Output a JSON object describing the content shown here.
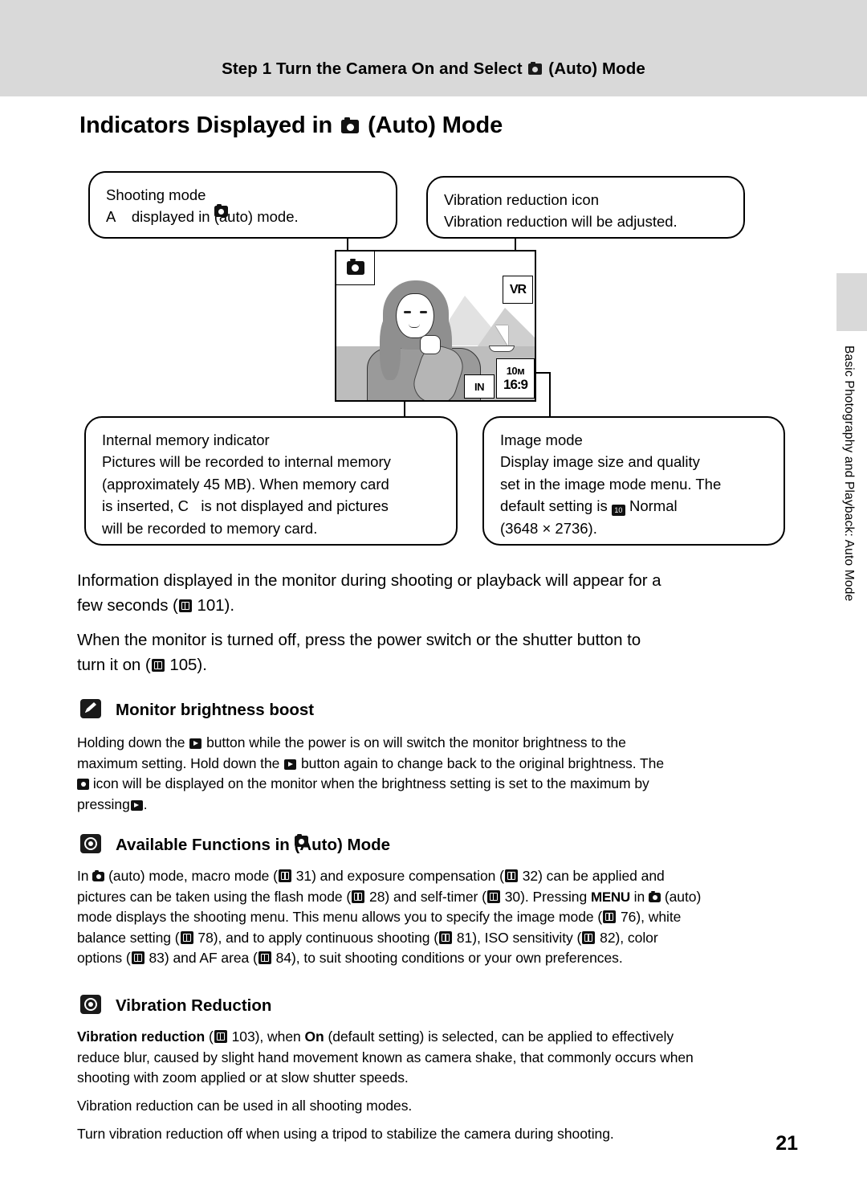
{
  "header": {
    "step_text_before": "Step 1 Turn the Camera On and Select",
    "step_text_after": "(Auto) Mode"
  },
  "title": {
    "before": "Indicators Displayed in",
    "after": "(Auto) Mode"
  },
  "side_tab_text": "Basic Photography and Playback: Auto Mode",
  "callouts": {
    "shooting_mode": {
      "line1": "Shooting mode",
      "line2_a": "A",
      "line2_b": "displayed in",
      "line2_c": "(auto) mode."
    },
    "vibration_reduction": {
      "line1": "Vibration reduction icon",
      "line2": "Vibration reduction will be adjusted."
    },
    "internal_memory": {
      "line1": "Internal memory indicator",
      "line2": "Pictures will be recorded to internal memory",
      "line3": "(approximately 45 MB). When memory card",
      "line4_a": "is inserted,",
      "line4_b": "C",
      "line4_c": "is not displayed and pictures",
      "line5": "will be recorded to memory card."
    },
    "image_mode": {
      "line1": "Image mode",
      "line2": "Display image size and quality",
      "line3": "set in the image mode menu. The",
      "line4_a": "default setting is",
      "line4_b": "Normal",
      "line5": "(3648 × 2736)."
    }
  },
  "monitor": {
    "mode_icon": "camera-auto-icon",
    "vr_icon_label": "VR",
    "internal_memory_label": "IN",
    "image_mode_top": "10м",
    "image_mode_bottom": "16:9"
  },
  "body": {
    "p1_a": "Information displayed in the monitor during shooting or playback will appear for a",
    "p1_b": "few seconds (",
    "p1_page": "101",
    "p1_c": ").",
    "p2_a": "When the monitor is turned off, press the power switch or the shutter button to",
    "p2_b": "turn it on (",
    "p2_page": "105",
    "p2_c": ")."
  },
  "sections": [
    {
      "icon": "pencil-icon",
      "heading": "Monitor brightness boost",
      "lines": [
        "Holding down the ▶ button while the power is on will switch the monitor brightness to the",
        "maximum setting. Hold down the ▶ button again to change back to the original brightness. The",
        "icon will be displayed on the monitor when the brightness setting is set to the maximum by",
        "pressing ▶."
      ]
    },
    {
      "icon": "note-icon",
      "heading_before": "Available Functions in",
      "heading_after": "(Auto) Mode",
      "lines": [
        "In  (auto) mode, macro mode ( 31) and exposure compensation ( 32) can be applied and",
        "pictures can be taken using the flash mode ( 28) and self-timer ( 30). Pressing MENU in  (auto)",
        "mode displays the shooting menu. This menu allows you to specify the image mode ( 76), white",
        "balance setting ( 78), and to apply continuous shooting ( 81), ISO sensitivity ( 82), color",
        "options ( 83) and AF area ( 84), to suit shooting conditions or your own preferences."
      ]
    },
    {
      "icon": "note-icon",
      "heading": "Vibration Reduction",
      "lines": [
        "Vibration reduction ( 103), when On (default setting) is selected, can be applied to effectively",
        "reduce blur, caused by slight hand movement known as camera shake, that commonly occurs when",
        "shooting with zoom applied or at slow shutter speeds.",
        "Vibration reduction can be used in all shooting modes.",
        "Turn vibration reduction off when using a tripod to stabilize the camera during shooting."
      ]
    }
  ],
  "available_functions_text": {
    "l1_a": "In",
    "l1_b": "(auto) mode, macro mode (",
    "l1_p1": "31",
    "l1_c": ") and exposure compensation (",
    "l1_p2": "32",
    "l1_d": ") can be applied and",
    "l2_a": "pictures can be taken using the flash mode (",
    "l2_p1": "28",
    "l2_b": ") and self-timer (",
    "l2_p2": "30",
    "l2_c": "). Pressing",
    "l2_menu": "MENU",
    "l2_d": "in",
    "l2_e": "(auto)",
    "l3_a": "mode displays the shooting menu. This menu allows you to specify the image mode (",
    "l3_p1": "76",
    "l3_b": "), white",
    "l4_a": "balance setting (",
    "l4_p1": "78",
    "l4_b": "), and to apply continuous shooting (",
    "l4_p2": "81",
    "l4_c": "), ISO sensitivity (",
    "l4_p3": "82",
    "l4_d": "), color",
    "l5_a": "options (",
    "l5_p1": "83",
    "l5_b": ") and AF area (",
    "l5_p2": "84",
    "l5_c": "), to suit shooting conditions or your own preferences."
  },
  "monitor_brightness_text": {
    "l1_a": "Holding down the",
    "l1_b": "button while the power is on will switch the monitor brightness to the",
    "l2_a": "maximum setting. Hold down the",
    "l2_b": "button again to change back to the original brightness. The",
    "l3_a": "icon will be displayed on the monitor when the brightness setting is set to the maximum by",
    "l4_a": "pressing",
    "l4_b": "."
  },
  "vibration_reduction_text": {
    "l1_a": "Vibration reduction",
    "l1_b": "(",
    "l1_p": "103",
    "l1_c": "), when",
    "l1_on": "On",
    "l1_d": "(default setting) is selected, can be applied to effectively",
    "l2": "reduce blur, caused by slight hand movement known as camera shake, that commonly occurs when",
    "l3": "shooting with zoom applied or at slow shutter speeds.",
    "l4": "Vibration reduction can be used in all shooting modes.",
    "l5": "Turn vibration reduction off when using a tripod to stabilize the camera during shooting."
  },
  "page_number": "21"
}
